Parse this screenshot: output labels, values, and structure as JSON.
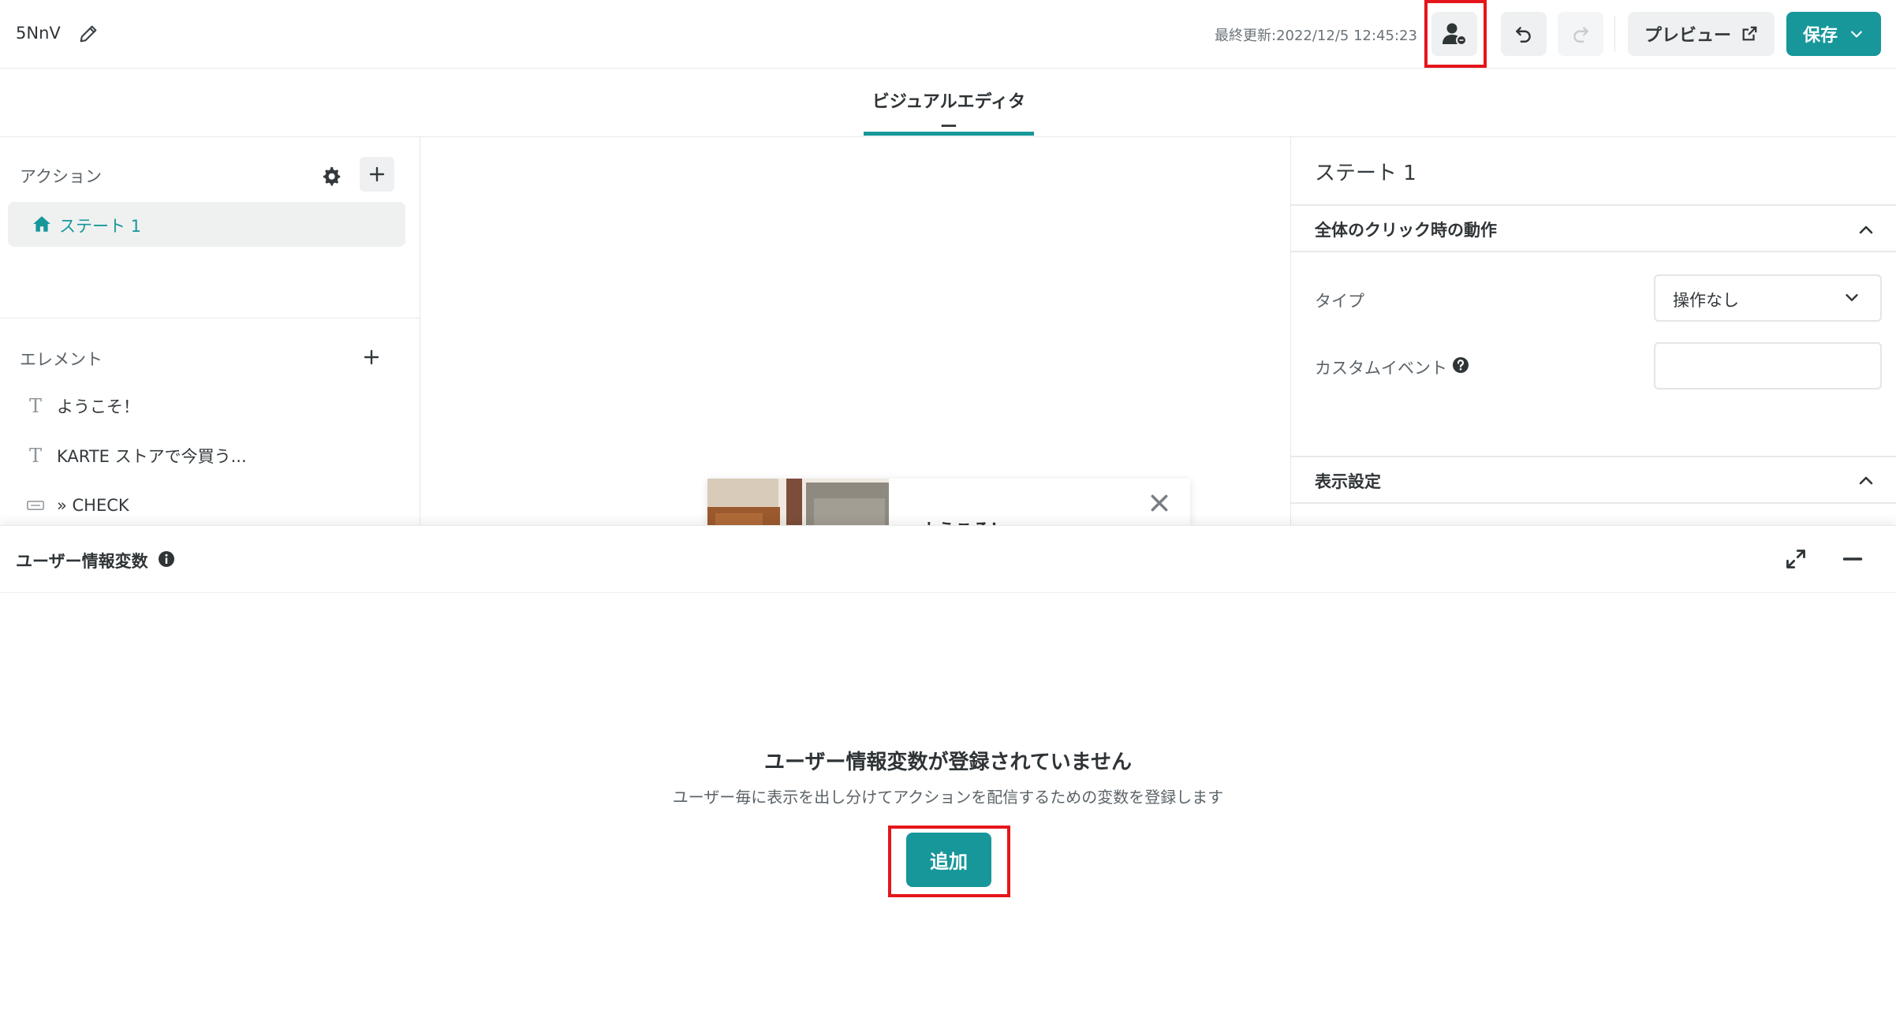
{
  "header": {
    "title": "5NnV",
    "last_updated": "最終更新:2022/12/5 12:45:23",
    "preview_label": "プレビュー",
    "save_label": "保存"
  },
  "tabs": [
    {
      "label": "ビジュアルエディター",
      "active": true
    }
  ],
  "left_panel": {
    "actions_label": "アクション",
    "states": [
      {
        "label": "ステート 1",
        "selected": true
      }
    ],
    "elements_label": "エレメント",
    "elements": [
      {
        "label": "ようこそ！",
        "icon": "text-icon"
      },
      {
        "label": "KARTE ストアで今買う...",
        "icon": "text-icon"
      },
      {
        "label": "» CHECK",
        "icon": "button-element-icon"
      }
    ]
  },
  "canvas": {
    "popup_title": "ようこそ！"
  },
  "right_panel": {
    "state_title": "ステート 1",
    "click_section_title": "全体のクリック時の動作",
    "type_label": "タイプ",
    "type_value": "操作なし",
    "custom_event_label": "カスタムイベント",
    "custom_event_value": "",
    "display_section_title": "表示設定"
  },
  "drawer": {
    "title": "ユーザー情報変数",
    "empty_title": "ユーザー情報変数が登録されていません",
    "empty_description": "ユーザー毎に表示を出し分けてアクションを配信するための変数を登録します",
    "add_button_label": "追加"
  },
  "colors": {
    "accent": "#17979a",
    "highlight": "#e5161b"
  }
}
